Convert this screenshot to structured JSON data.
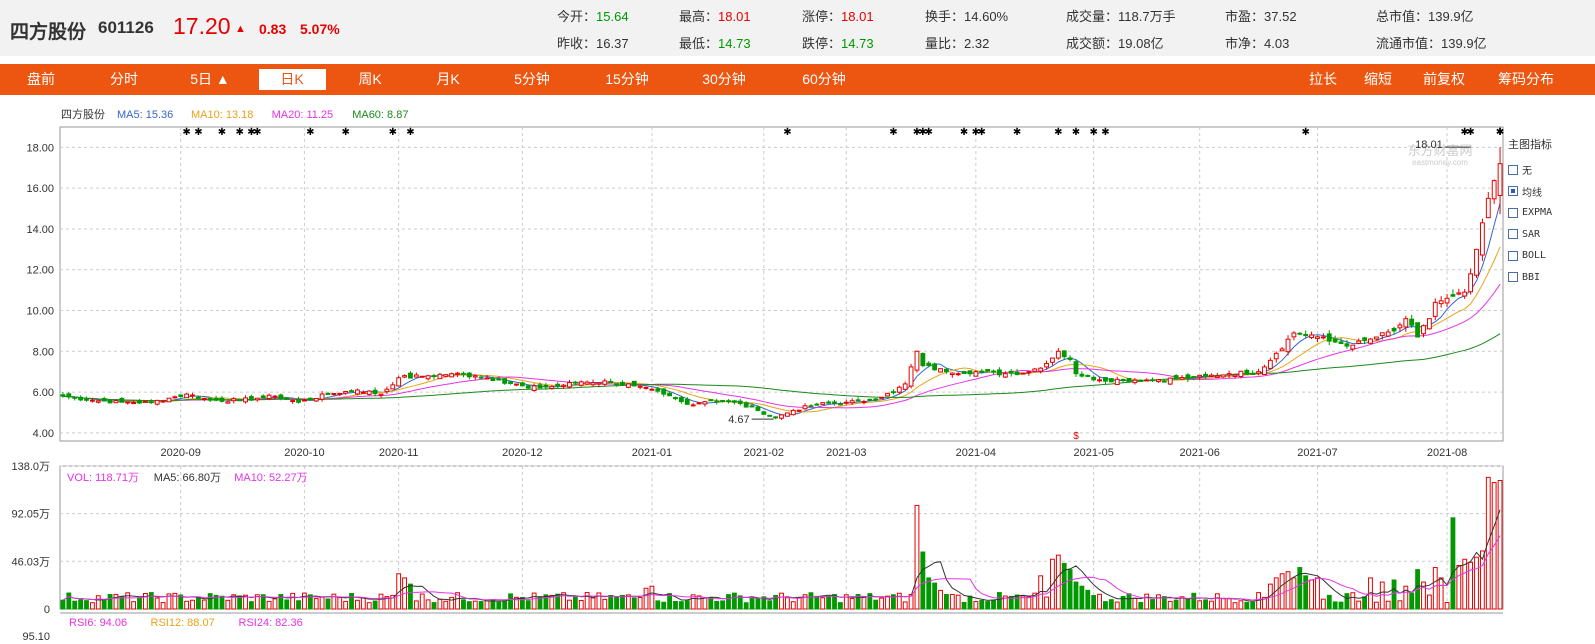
{
  "quote": {
    "name": "四方股份",
    "code": "601126",
    "price": "17.20",
    "arrow": "▲",
    "change": "0.83",
    "change_pct": "5.07%"
  },
  "stats": [
    {
      "label": "今开：",
      "value": "15.64",
      "tone": "down"
    },
    {
      "label": "最高：",
      "value": "18.01",
      "tone": "up"
    },
    {
      "label": "涨停：",
      "value": "18.01",
      "tone": "up"
    },
    {
      "label": "换手：",
      "value": "14.60%",
      "tone": ""
    },
    {
      "label": "成交量：",
      "value": "118.7万手",
      "tone": ""
    },
    {
      "label": "市盈：",
      "value": "37.52",
      "tone": ""
    },
    {
      "label": "总市值：",
      "value": "139.9亿",
      "tone": ""
    },
    {
      "label": "昨收：",
      "value": "16.37",
      "tone": ""
    },
    {
      "label": "最低：",
      "value": "14.73",
      "tone": "down"
    },
    {
      "label": "跌停：",
      "value": "14.73",
      "tone": "down"
    },
    {
      "label": "量比：",
      "value": "2.32",
      "tone": ""
    },
    {
      "label": "成交额：",
      "value": "19.08亿",
      "tone": ""
    },
    {
      "label": "市净：",
      "value": "4.03",
      "tone": ""
    },
    {
      "label": "流通市值：",
      "value": "139.9亿",
      "tone": ""
    }
  ],
  "tabs_left": [
    "盘前",
    "分时",
    "5日 ▲",
    "日K",
    "周K",
    "月K",
    "5分钟",
    "15分钟",
    "30分钟",
    "60分钟"
  ],
  "active_tab": "日K",
  "tabs_right": [
    "拉长",
    "缩短",
    "前复权 ▲",
    "筹码分布"
  ],
  "indicator_panel": {
    "title": "主图指标",
    "items": [
      {
        "label": "无",
        "checked": false
      },
      {
        "label": "均线",
        "checked": true
      },
      {
        "label": "EXPMA",
        "checked": false
      },
      {
        "label": "SAR",
        "checked": false
      },
      {
        "label": "BOLL",
        "checked": false
      },
      {
        "label": "BBI",
        "checked": false
      }
    ]
  },
  "colors": {
    "up": "#e60000",
    "down": "#009900",
    "ma5": "#3366cc",
    "ma10": "#e8a317",
    "ma20": "#e633e6",
    "ma60": "#1a8a1a",
    "accent": "#ec5611"
  },
  "chart_data": [
    {
      "type": "candlestick",
      "legend": [
        {
          "text": "四方股份",
          "color": "#333333"
        },
        {
          "text": "MA5: 15.36",
          "color": "#3366cc"
        },
        {
          "text": "MA10: 13.18",
          "color": "#e8a317"
        },
        {
          "text": "MA20: 11.25",
          "color": "#e633e6"
        },
        {
          "text": "MA60: 8.87",
          "color": "#1a8a1a"
        }
      ],
      "ylim": [
        3.6,
        19.0
      ],
      "yticks": [
        "18.00",
        "16.00",
        "14.00",
        "12.00",
        "10.00",
        "8.00",
        "6.00",
        "4.00"
      ],
      "ytick_values": [
        18,
        16,
        14,
        12,
        10,
        8,
        6,
        4
      ],
      "x_month_labels": [
        {
          "label": "2020-09",
          "index": 20
        },
        {
          "label": "2020-10",
          "index": 41
        },
        {
          "label": "2020-11",
          "index": 57
        },
        {
          "label": "2020-12",
          "index": 78
        },
        {
          "label": "2021-01",
          "index": 100
        },
        {
          "label": "2021-02",
          "index": 119
        },
        {
          "label": "2021-03",
          "index": 133
        },
        {
          "label": "2021-04",
          "index": 155
        },
        {
          "label": "2021-05",
          "index": 175
        },
        {
          "label": "2021-06",
          "index": 193
        },
        {
          "label": "2021-07",
          "index": 213
        },
        {
          "label": "2021-08",
          "index": 235
        }
      ],
      "annotations": [
        {
          "text": "18.01",
          "index": 238,
          "value": 18.01
        },
        {
          "text": "4.67",
          "index": 121,
          "value": 4.67
        }
      ],
      "watermark": [
        "东方财富网",
        "eastmoney.com"
      ],
      "anchors": [
        {
          "index": 0,
          "close": 5.8
        },
        {
          "index": 5,
          "close": 5.6
        },
        {
          "index": 10,
          "close": 5.5
        },
        {
          "index": 15,
          "close": 5.5
        },
        {
          "index": 18,
          "close": 5.7
        },
        {
          "index": 21,
          "close": 5.9
        },
        {
          "index": 25,
          "close": 5.6
        },
        {
          "index": 30,
          "close": 5.6
        },
        {
          "index": 33,
          "close": 5.7
        },
        {
          "index": 36,
          "close": 5.8
        },
        {
          "index": 40,
          "close": 5.5
        },
        {
          "index": 45,
          "close": 5.9
        },
        {
          "index": 50,
          "close": 6.1
        },
        {
          "index": 54,
          "close": 5.9
        },
        {
          "index": 57,
          "close": 6.7
        },
        {
          "index": 62,
          "close": 6.8
        },
        {
          "index": 66,
          "close": 6.9
        },
        {
          "index": 70,
          "close": 6.8
        },
        {
          "index": 74,
          "close": 6.6
        },
        {
          "index": 79,
          "close": 6.2
        },
        {
          "index": 84,
          "close": 6.3
        },
        {
          "index": 88,
          "close": 6.5
        },
        {
          "index": 93,
          "close": 6.5
        },
        {
          "index": 97,
          "close": 6.3
        },
        {
          "index": 102,
          "close": 5.9
        },
        {
          "index": 106,
          "close": 5.4
        },
        {
          "index": 110,
          "close": 5.6
        },
        {
          "index": 114,
          "close": 5.5
        },
        {
          "index": 118,
          "close": 5.1
        },
        {
          "index": 121,
          "close": 4.75
        },
        {
          "index": 124,
          "close": 5.1
        },
        {
          "index": 128,
          "close": 5.4
        },
        {
          "index": 133,
          "close": 5.5
        },
        {
          "index": 137,
          "close": 5.6
        },
        {
          "index": 141,
          "close": 6.0
        },
        {
          "index": 143,
          "close": 6.4
        },
        {
          "index": 145,
          "close": 8.0
        },
        {
          "index": 146,
          "close": 7.3
        },
        {
          "index": 150,
          "close": 7.0
        },
        {
          "index": 155,
          "close": 7.0
        },
        {
          "index": 160,
          "close": 6.9
        },
        {
          "index": 164,
          "close": 7.0
        },
        {
          "index": 167,
          "close": 7.4
        },
        {
          "index": 169,
          "close": 8.0
        },
        {
          "index": 171,
          "close": 7.6
        },
        {
          "index": 172,
          "close": 6.9
        },
        {
          "index": 176,
          "close": 6.6
        },
        {
          "index": 180,
          "close": 6.6
        },
        {
          "index": 186,
          "close": 6.6
        },
        {
          "index": 192,
          "close": 6.7
        },
        {
          "index": 198,
          "close": 6.9
        },
        {
          "index": 203,
          "close": 7.0
        },
        {
          "index": 206,
          "close": 7.9
        },
        {
          "index": 209,
          "close": 8.9
        },
        {
          "index": 212,
          "close": 8.8
        },
        {
          "index": 215,
          "close": 8.5
        },
        {
          "index": 219,
          "close": 8.3
        },
        {
          "index": 222,
          "close": 8.6
        },
        {
          "index": 226,
          "close": 9.0
        },
        {
          "index": 228,
          "close": 9.6
        },
        {
          "index": 230,
          "close": 8.7
        },
        {
          "index": 232,
          "close": 9.6
        },
        {
          "index": 233,
          "close": 10.4
        },
        {
          "index": 236,
          "close": 10.7
        },
        {
          "index": 238,
          "close": 10.9
        },
        {
          "index": 239,
          "close": 11.8
        },
        {
          "index": 240,
          "close": 13.0
        },
        {
          "index": 241,
          "close": 14.3
        },
        {
          "index": 242,
          "close": 15.5
        },
        {
          "index": 243,
          "close": 16.37
        },
        {
          "index": 244,
          "close": 17.2
        }
      ],
      "last_bar": {
        "open": 15.64,
        "high": 18.01,
        "low": 14.73,
        "close": 17.2
      }
    },
    {
      "type": "bar",
      "legend": [
        {
          "text": "VOL: 118.71万",
          "color": "#e633e6"
        },
        {
          "text": "MA5: 66.80万",
          "color": "#333333"
        },
        {
          "text": "MA10: 52.27万",
          "color": "#e633e6"
        }
      ],
      "yticks": [
        "138.0万",
        "92.05万",
        "46.03万",
        "0"
      ],
      "ytick_values": [
        138.0,
        92.05,
        46.03,
        0
      ],
      "ylim": [
        0,
        138.0
      ],
      "spikes": [
        {
          "index": 145,
          "value": 100
        },
        {
          "index": 146,
          "value": 55
        },
        {
          "index": 169,
          "value": 52
        },
        {
          "index": 170,
          "value": 44
        },
        {
          "index": 171,
          "value": 38
        },
        {
          "index": 230,
          "value": 38
        },
        {
          "index": 236,
          "value": 88
        },
        {
          "index": 242,
          "value": 127
        },
        {
          "index": 243,
          "value": 122
        }
      ]
    },
    {
      "type": "line",
      "legend": [
        {
          "text": "RSI6: 94.06",
          "color": "#e633e6"
        },
        {
          "text": "RSI12: 88.07",
          "color": "#e8a317"
        },
        {
          "text": "RSI24: 82.36",
          "color": "#e633e6"
        }
      ],
      "yticks": [
        "95.10"
      ]
    }
  ]
}
